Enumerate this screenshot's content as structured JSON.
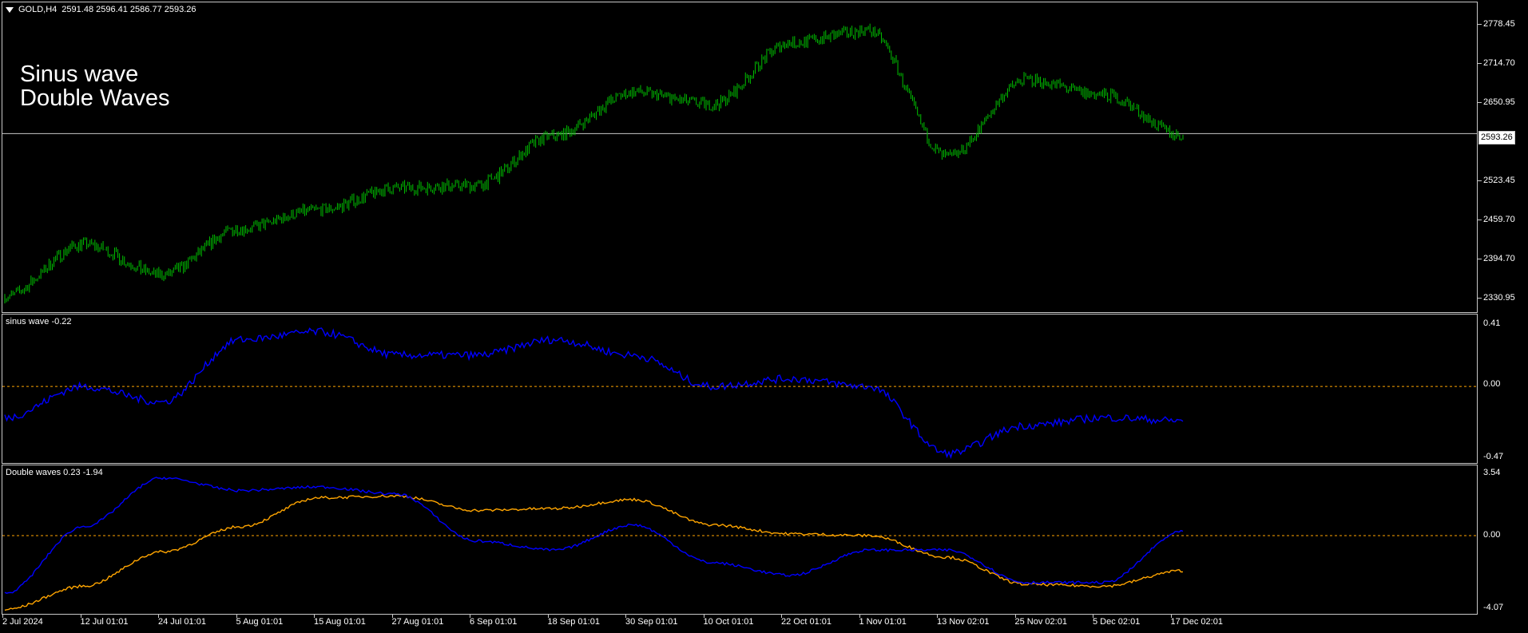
{
  "symbol_header": {
    "symbol": "GOLD,H4",
    "ohlc": "2591.48 2596.41 2586.77 2593.26"
  },
  "overlay_text": {
    "line1": "Sinus wave",
    "line2": "Double Waves"
  },
  "price_axis": [
    "2778.45",
    "2714.70",
    "2650.95",
    "2523.45",
    "2459.70",
    "2394.70",
    "2330.95"
  ],
  "current_price": "2593.26",
  "sinus_indicator": {
    "title": "sinus wave -0.22",
    "axis": [
      "0.41",
      "0.00",
      "-0.47"
    ]
  },
  "double_indicator": {
    "title": "Double waves 0.23 -1.94",
    "axis": [
      "3.54",
      "0.00",
      "-4.07"
    ]
  },
  "time_axis": [
    "2 Jul 2024",
    "12 Jul 01:01",
    "24 Jul 01:01",
    "5 Aug 01:01",
    "15 Aug 01:01",
    "27 Aug 01:01",
    "6 Sep 01:01",
    "18 Sep 01:01",
    "30 Sep 01:01",
    "10 Oct 01:01",
    "22 Oct 01:01",
    "1 Nov 01:01",
    "13 Nov 02:01",
    "25 Nov 02:01",
    "5 Dec 02:01",
    "17 Dec 02:01"
  ],
  "colors": {
    "background": "#000000",
    "candles": "#00c000",
    "sinus_line": "#0000ff",
    "double_line_1": "#0000ff",
    "double_line_2": "#ffa500",
    "zero_level": "#ffa500",
    "grid_border": "#c8c8c8"
  },
  "chart_data": [
    {
      "type": "line",
      "title": "GOLD,H4",
      "x": [
        "2 Jul 2024",
        "12 Jul",
        "24 Jul",
        "5 Aug",
        "15 Aug",
        "27 Aug",
        "6 Sep",
        "18 Sep",
        "30 Sep",
        "10 Oct",
        "22 Oct",
        "1 Nov",
        "13 Nov",
        "25 Nov",
        "5 Dec",
        "17 Dec"
      ],
      "series": [
        {
          "values": [
            2330,
            2415,
            2365,
            2440,
            2470,
            2505,
            2510,
            2590,
            2660,
            2640,
            2740,
            2760,
            2555,
            2680,
            2655,
            2590
          ]
        }
      ],
      "ylim": [
        2310,
        2800
      ]
    },
    {
      "type": "line",
      "title": "sinus wave -0.22",
      "x": [
        "2 Jul 2024",
        "12 Jul",
        "24 Jul",
        "5 Aug",
        "15 Aug",
        "27 Aug",
        "6 Sep",
        "18 Sep",
        "30 Sep",
        "10 Oct",
        "22 Oct",
        "1 Nov",
        "13 Nov",
        "25 Nov",
        "5 Dec",
        "17 Dec"
      ],
      "series": [
        {
          "values": [
            -0.2,
            0.0,
            -0.1,
            0.3,
            0.35,
            0.2,
            0.2,
            0.3,
            0.2,
            0.0,
            0.05,
            0.0,
            -0.43,
            -0.25,
            -0.2,
            -0.22
          ]
        }
      ],
      "ylim": [
        -0.47,
        0.41
      ]
    },
    {
      "type": "line",
      "title": "Double waves 0.23 -1.94",
      "x": [
        "2 Jul 2024",
        "12 Jul",
        "24 Jul",
        "5 Aug",
        "15 Aug",
        "27 Aug",
        "6 Sep",
        "18 Sep",
        "30 Sep",
        "10 Oct",
        "22 Oct",
        "1 Nov",
        "13 Nov",
        "25 Nov",
        "5 Dec",
        "17 Dec"
      ],
      "series": [
        {
          "values": [
            -3.2,
            0.5,
            3.2,
            2.5,
            2.7,
            2.3,
            -0.3,
            -0.8,
            0.6,
            -1.5,
            -2.2,
            -0.8,
            -0.8,
            -2.6,
            -2.6,
            0.23
          ]
        },
        {
          "values": [
            -4.1,
            -2.8,
            -0.9,
            0.5,
            2.1,
            2.2,
            1.4,
            1.5,
            2.0,
            0.6,
            0.1,
            0.0,
            -1.2,
            -2.7,
            -2.8,
            -1.94
          ]
        }
      ],
      "ylim": [
        -4.07,
        3.54
      ]
    }
  ]
}
